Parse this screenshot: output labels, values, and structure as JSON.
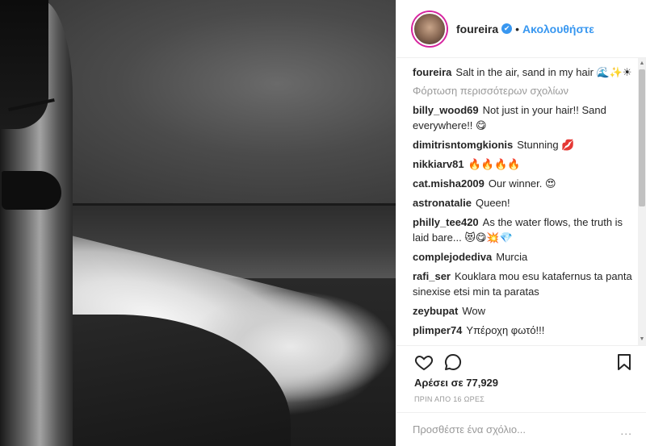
{
  "author": {
    "username": "foureira",
    "verified_mark": "✔",
    "separator": "•",
    "follow_label": "Ακολουθήστε"
  },
  "caption": {
    "username": "foureira",
    "text": "Salt in the air, sand in my hair 🌊✨☀"
  },
  "load_more_label": "Φόρτωση περισσότερων σχολίων",
  "comments": [
    {
      "user": "billy_wood69",
      "text": "Not just in your hair!! Sand everywhere!! 😋"
    },
    {
      "user": "dimitrisntomgkionis",
      "text": "Stunning 💋"
    },
    {
      "user": "nikkiarv81",
      "text": "🔥🔥🔥🔥"
    },
    {
      "user": "cat.misha2009",
      "text": "Our winner. 😍"
    },
    {
      "user": "astronatalie",
      "text": "Queen!"
    },
    {
      "user": "philly_tee420",
      "text": "As the water flows, the truth is laid bare... 😻😋💥💎"
    },
    {
      "user": "complejodediva",
      "text": "Murcia"
    },
    {
      "user": "rafi_ser",
      "text": "Kouklara mou esu katafernus ta panta sinexise etsi min ta paratas"
    },
    {
      "user": "zeybupat",
      "text": "Wow"
    },
    {
      "user": "plimper74",
      "text": "Υπέροχη φωτό!!!"
    }
  ],
  "likes_text": "Αρέσει σε 77,929",
  "timestamp": "ΠΡΙΝ ΑΠΟ 16 ΩΡΕΣ",
  "add_comment": {
    "placeholder": "Προσθέστε ένα σχόλιο...",
    "more": "..."
  },
  "scrollbar": {
    "up": "▲",
    "down": "▼"
  },
  "icons": {
    "like": "heart-icon",
    "comment": "comment-bubble-icon",
    "save": "bookmark-icon"
  },
  "colors": {
    "link_blue": "#3897f0",
    "text": "#262626",
    "muted": "#999999"
  }
}
